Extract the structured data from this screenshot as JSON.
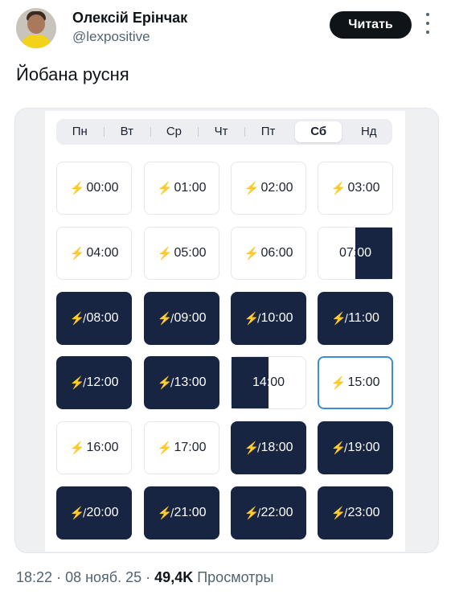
{
  "author": {
    "name": "Олексій Ерінчак",
    "handle": "@lexpositive",
    "follow_label": "Читать"
  },
  "tweet": {
    "text": "Йобана русня"
  },
  "schedule": {
    "days": [
      {
        "label": "Пн",
        "active": false
      },
      {
        "label": "Вт",
        "active": false
      },
      {
        "label": "Ср",
        "active": false
      },
      {
        "label": "Чт",
        "active": false
      },
      {
        "label": "Пт",
        "active": false
      },
      {
        "label": "Сб",
        "active": true
      },
      {
        "label": "Нд",
        "active": false
      }
    ],
    "slots": [
      {
        "time": "00:00",
        "status": "on"
      },
      {
        "time": "01:00",
        "status": "on"
      },
      {
        "time": "02:00",
        "status": "on"
      },
      {
        "time": "03:00",
        "status": "on"
      },
      {
        "time": "04:00",
        "status": "on"
      },
      {
        "time": "05:00",
        "status": "on"
      },
      {
        "time": "06:00",
        "status": "on"
      },
      {
        "time": "07:00",
        "status": "partial-right",
        "outage_fraction": 0.5
      },
      {
        "time": "08:00",
        "status": "off"
      },
      {
        "time": "09:00",
        "status": "off"
      },
      {
        "time": "10:00",
        "status": "off"
      },
      {
        "time": "11:00",
        "status": "off"
      },
      {
        "time": "12:00",
        "status": "off"
      },
      {
        "time": "13:00",
        "status": "off"
      },
      {
        "time": "14:00",
        "status": "partial-left",
        "outage_fraction": 0.5
      },
      {
        "time": "15:00",
        "status": "on",
        "selected": true
      },
      {
        "time": "16:00",
        "status": "on"
      },
      {
        "time": "17:00",
        "status": "on"
      },
      {
        "time": "18:00",
        "status": "off"
      },
      {
        "time": "19:00",
        "status": "off"
      },
      {
        "time": "20:00",
        "status": "off"
      },
      {
        "time": "21:00",
        "status": "off"
      },
      {
        "time": "22:00",
        "status": "off"
      },
      {
        "time": "23:00",
        "status": "off"
      }
    ],
    "icons": {
      "on": "lightning-bolt-icon",
      "off": "crossed-out-lightning-icon"
    },
    "colors": {
      "outage": "#172442",
      "power": "#f2b705",
      "selected_border": "#3b8ed8"
    }
  },
  "meta": {
    "time": "18:22",
    "date": "08 нояб. 25",
    "views_count": "49,4K",
    "views_label": "Просмотры",
    "sep": "·"
  }
}
